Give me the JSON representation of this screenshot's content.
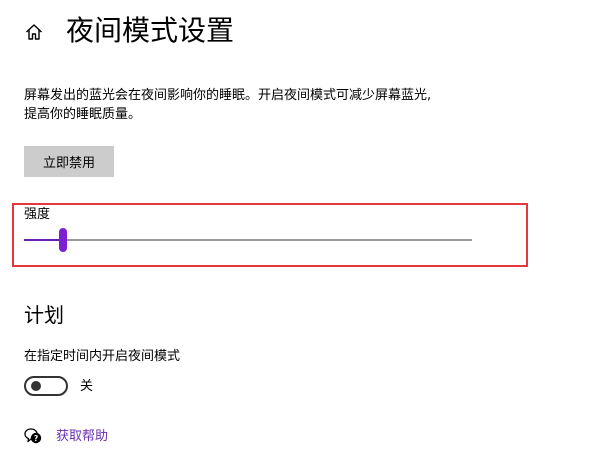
{
  "header": {
    "home_icon": "home-icon",
    "title": "夜间模式设置"
  },
  "description": {
    "line1": "屏幕发出的蓝光会在夜间影响你的睡眠。开启夜间模式可减少屏幕蓝光,",
    "line2": "提高你的睡眠质量。"
  },
  "disable_now_button": {
    "label": "立即禁用"
  },
  "strength": {
    "label": "强度",
    "value_fraction": 0.087,
    "accent_color": "#7a1fd1"
  },
  "highlight_color": "#e4393c",
  "schedule": {
    "section_title": "计划",
    "toggle_label": "在指定时间内开启夜间模式",
    "toggle_state": "关",
    "toggle_on": false
  },
  "help": {
    "icon": "help-chat-icon",
    "link_text": "获取帮助",
    "link_color": "#6b2fb3"
  }
}
